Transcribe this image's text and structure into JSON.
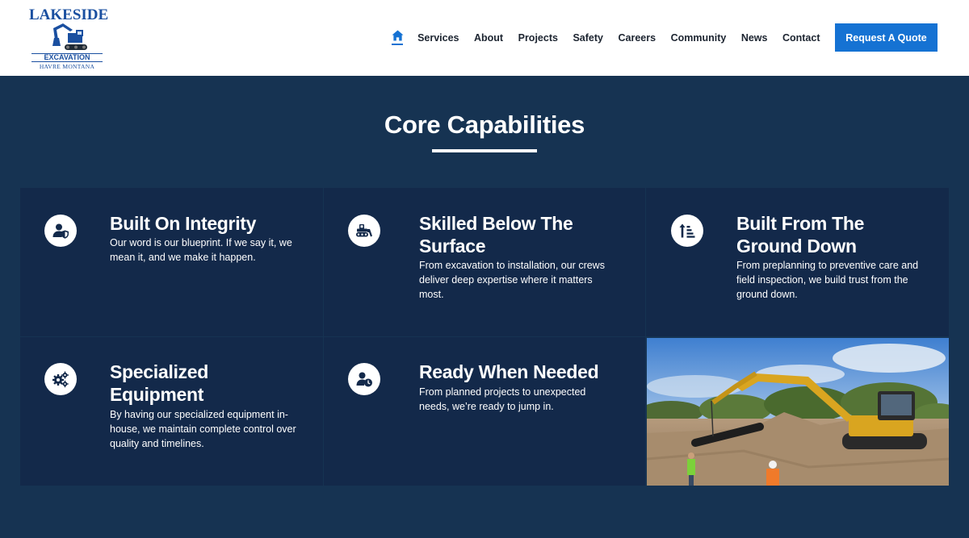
{
  "logo": {
    "top": "LAKESIDE",
    "middle": "EXCAVATION",
    "bottom": "HAVRE MONTANA"
  },
  "nav": {
    "items": [
      "Services",
      "About",
      "Projects",
      "Safety",
      "Careers",
      "Community",
      "News",
      "Contact"
    ],
    "cta": "Request A Quote"
  },
  "section": {
    "title": "Core Capabilities"
  },
  "cards": [
    {
      "icon": "user-shield-icon",
      "title": "Built On Integrity",
      "text": "Our word is our blueprint. If we say it, we mean it, and we make it happen."
    },
    {
      "icon": "bulldozer-icon",
      "title": "Skilled Below The Surface",
      "text": "From excavation to installation, our crews deliver deep expertise where it matters most."
    },
    {
      "icon": "sort-arrow-icon",
      "title": "Built From The Ground Down",
      "text": "From preplanning to preventive care and field inspection, we build trust from the ground down."
    },
    {
      "icon": "gears-icon",
      "title": "Specialized Equipment",
      "text": "By having our specialized equipment in-house, we maintain complete control over quality and timelines."
    },
    {
      "icon": "user-clock-icon",
      "title": "Ready When Needed",
      "text": "From planned projects to unexpected needs, we’re ready to jump in."
    }
  ],
  "colors": {
    "accent": "#1572d3",
    "background": "#163352",
    "card": "#13294a"
  }
}
